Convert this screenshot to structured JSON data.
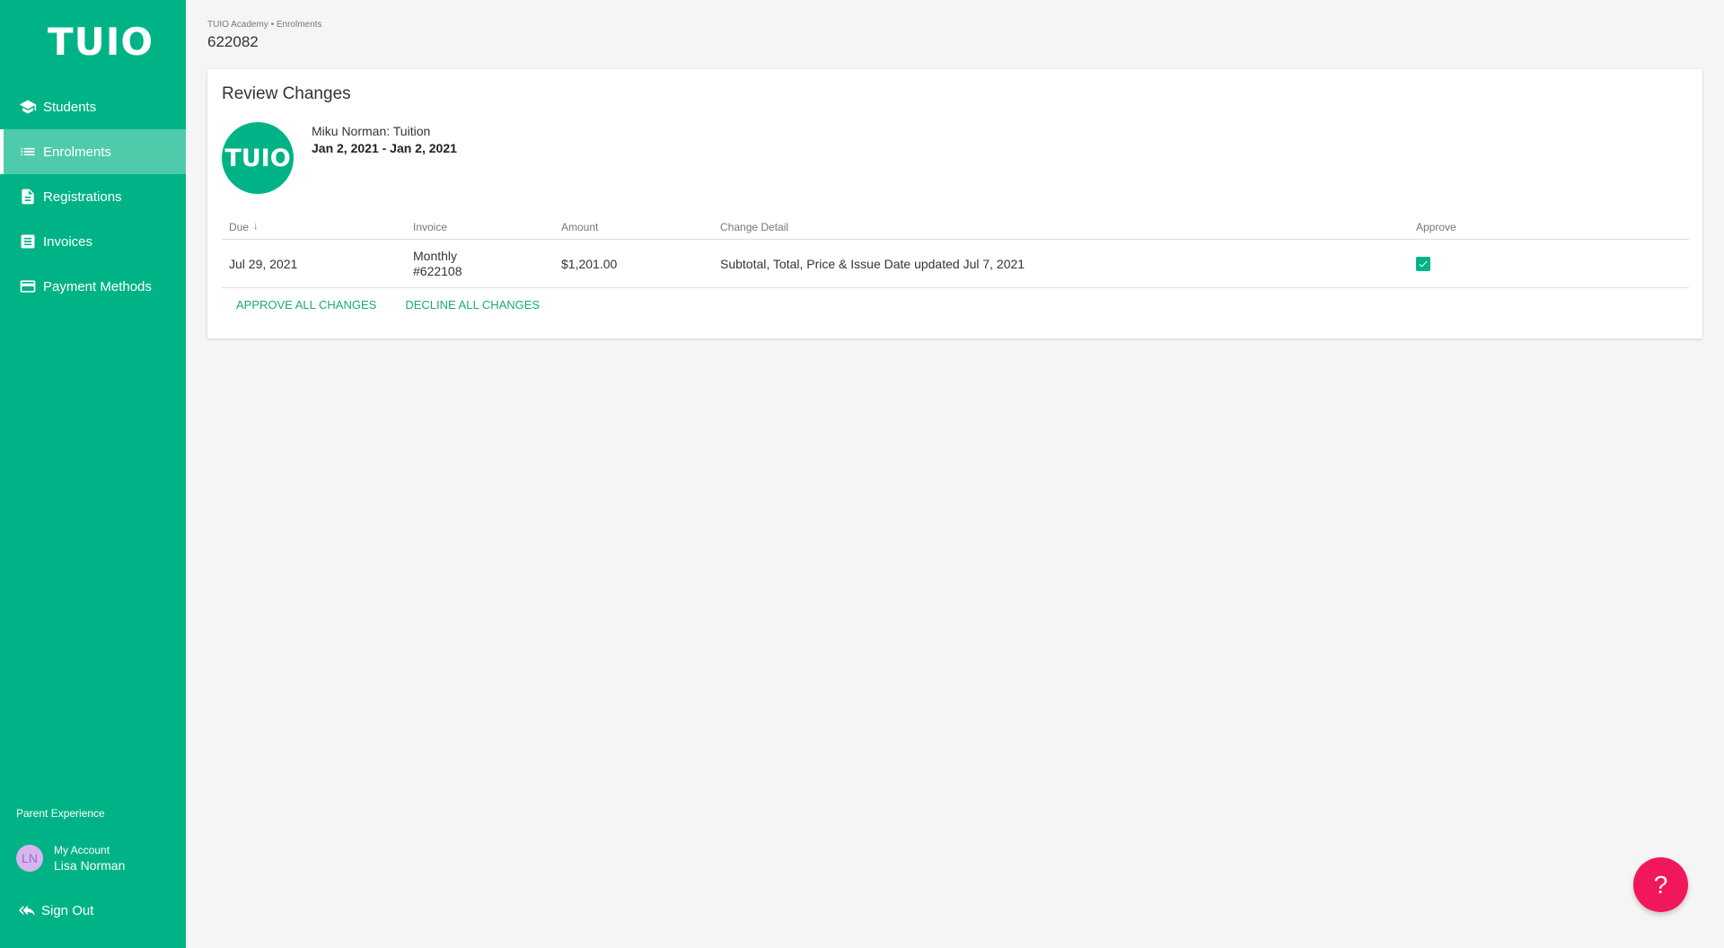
{
  "brand": {
    "logo_text": "TUIO",
    "color": "#00b386",
    "help_color": "#f0175a"
  },
  "sidebar": {
    "items": [
      {
        "label": "Students",
        "icon": "graduation-cap-icon",
        "active": false
      },
      {
        "label": "Enrolments",
        "icon": "list-icon",
        "active": true
      },
      {
        "label": "Registrations",
        "icon": "document-icon",
        "active": false
      },
      {
        "label": "Invoices",
        "icon": "invoice-icon",
        "active": false
      },
      {
        "label": "Payment Methods",
        "icon": "credit-card-icon",
        "active": false
      }
    ],
    "footer_title": "Parent Experience",
    "account": {
      "initials": "LN",
      "label": "My Account",
      "name": "Lisa Norman"
    },
    "sign_out": "Sign Out"
  },
  "header": {
    "breadcrumb": "TUIO Academy • Enrolments",
    "title": "622082"
  },
  "card": {
    "title": "Review Changes",
    "enrolment": {
      "logo_text": "TUIO",
      "name": "Miku Norman: Tuition",
      "dates": "Jan 2, 2021 - Jan 2, 2021"
    },
    "table": {
      "headers": {
        "due": "Due",
        "due_sort": "↓",
        "invoice": "Invoice",
        "amount": "Amount",
        "detail": "Change Detail",
        "approve": "Approve"
      },
      "rows": [
        {
          "due": "Jul 29, 2021",
          "invoice_type": "Monthly",
          "invoice_number": "#622108",
          "amount": "$1,201.00",
          "detail": "Subtotal, Total, Price & Issue Date updated Jul 7, 2021",
          "approved": true
        }
      ]
    },
    "actions": {
      "approve_all": "APPROVE ALL CHANGES",
      "decline_all": "DECLINE ALL CHANGES"
    }
  },
  "help": {
    "label": "?",
    "icon": "help-icon"
  }
}
